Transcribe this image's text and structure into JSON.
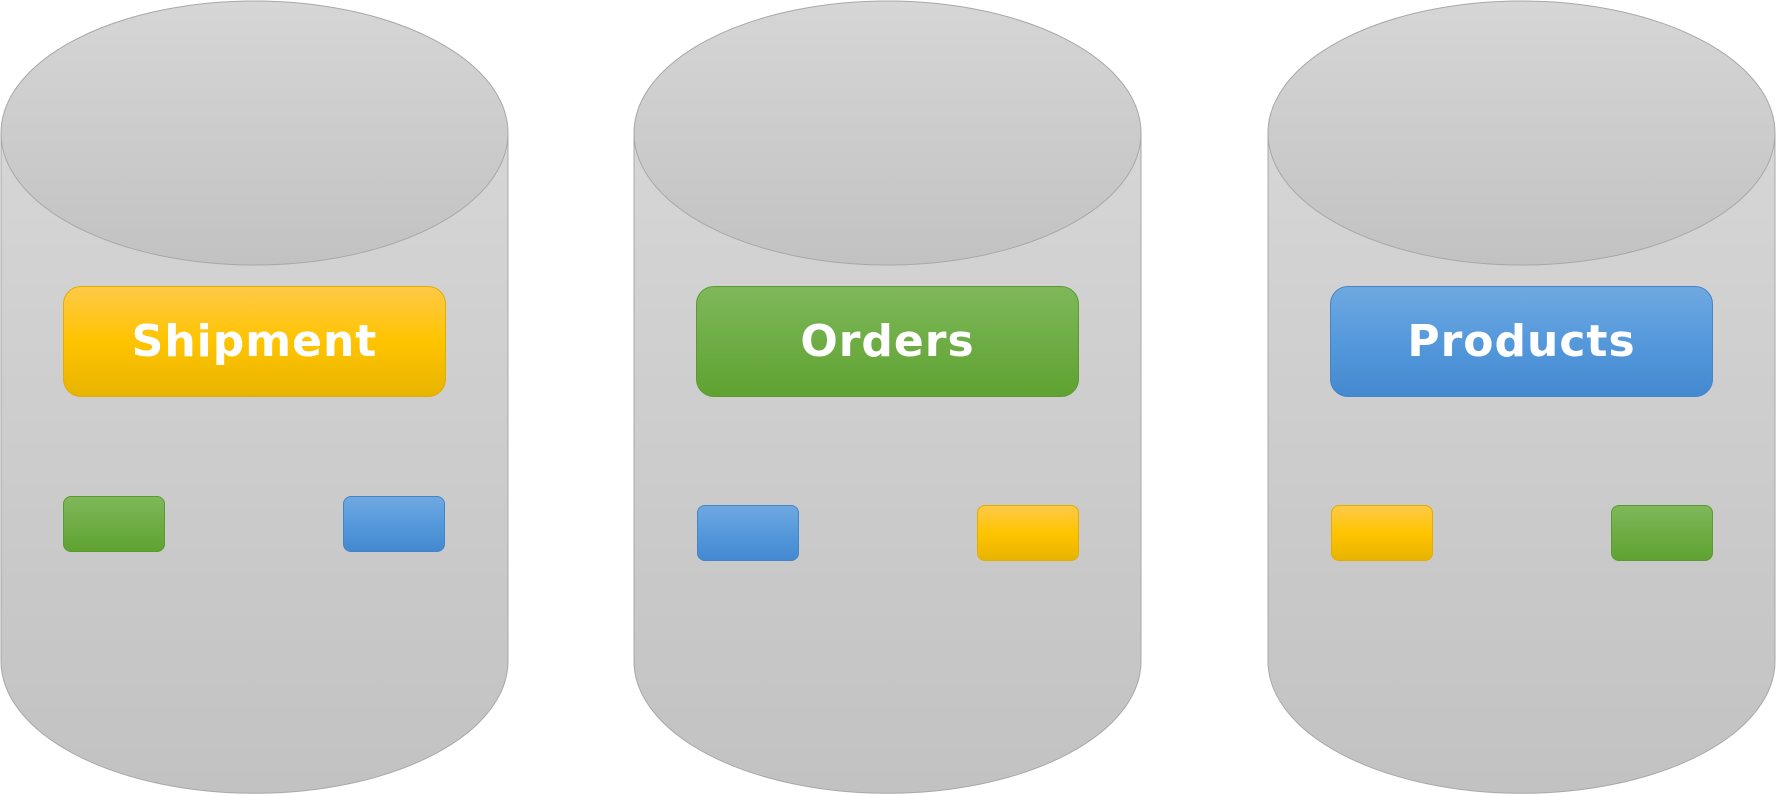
{
  "databases": [
    {
      "label": "Shipment",
      "label_color": "#ffc400",
      "chips": [
        {
          "color": "#6ead45"
        },
        {
          "color": "#5599dc"
        }
      ]
    },
    {
      "label": "Orders",
      "label_color": "#6ead45",
      "chips": [
        {
          "color": "#5599dc"
        },
        {
          "color": "#ffc400"
        }
      ]
    },
    {
      "label": "Products",
      "label_color": "#5599dc",
      "chips": [
        {
          "color": "#ffc400"
        },
        {
          "color": "#6ead45"
        }
      ]
    }
  ],
  "colors": {
    "cylinder_top": "#d6d6d6",
    "cylinder_bottom": "#c2c2c2",
    "cylinder_stroke": "#a8a8a8",
    "label_text": "#ffffff"
  }
}
